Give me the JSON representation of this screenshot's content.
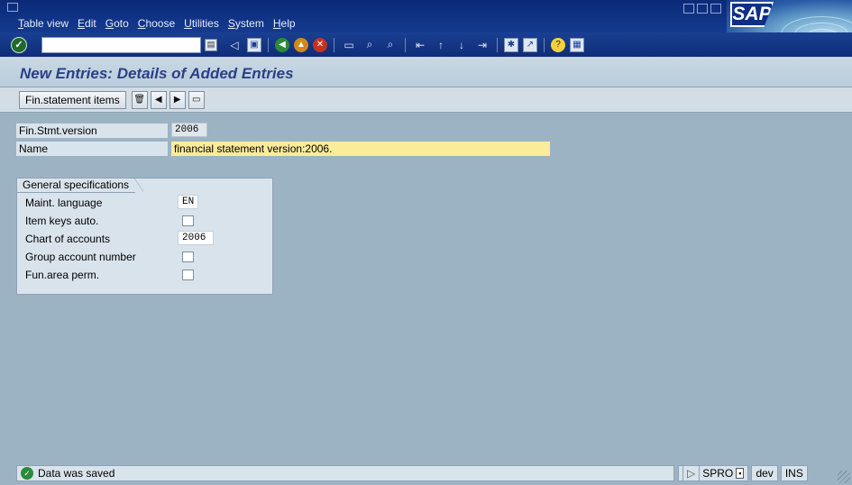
{
  "menu": {
    "items": [
      "Table view",
      "Edit",
      "Goto",
      "Choose",
      "Utilities",
      "System",
      "Help"
    ]
  },
  "logo": {
    "text": "SAP"
  },
  "toolbar": {
    "command_value": "",
    "icons": [
      "enter-icon",
      "back-icon",
      "save-icon",
      "back-green-icon",
      "exit-icon",
      "cancel-icon",
      "print-icon",
      "find-icon",
      "find-next-icon",
      "first-page-icon",
      "prev-page-icon",
      "next-page-icon",
      "last-page-icon",
      "create-session-icon",
      "shortcut-icon",
      "help-icon",
      "layout-icon"
    ]
  },
  "title": "New Entries: Details of Added Entries",
  "app_toolbar": {
    "button_label": "Fin.statement items"
  },
  "header_fields": {
    "version_label": "Fin.Stmt.version",
    "version_value": "2006",
    "name_label": "Name",
    "name_value": "financial statement version:2006."
  },
  "group": {
    "title": "General specifications",
    "maint_language_label": "Maint. language",
    "maint_language_value": "EN",
    "item_keys_label": "Item keys auto.",
    "item_keys_checked": false,
    "chart_label": "Chart of accounts",
    "chart_value": "2006",
    "group_acct_label": "Group account number",
    "group_acct_checked": false,
    "fun_area_label": "Fun.area perm.",
    "fun_area_checked": false
  },
  "status": {
    "message": "Data was saved",
    "transaction": "SPRO",
    "system": "dev",
    "mode": "INS"
  },
  "colors": {
    "menubar": "#0b2a78",
    "background": "#9cb3c4",
    "title": "#2b3f86",
    "highlight": "#fbec9a"
  }
}
